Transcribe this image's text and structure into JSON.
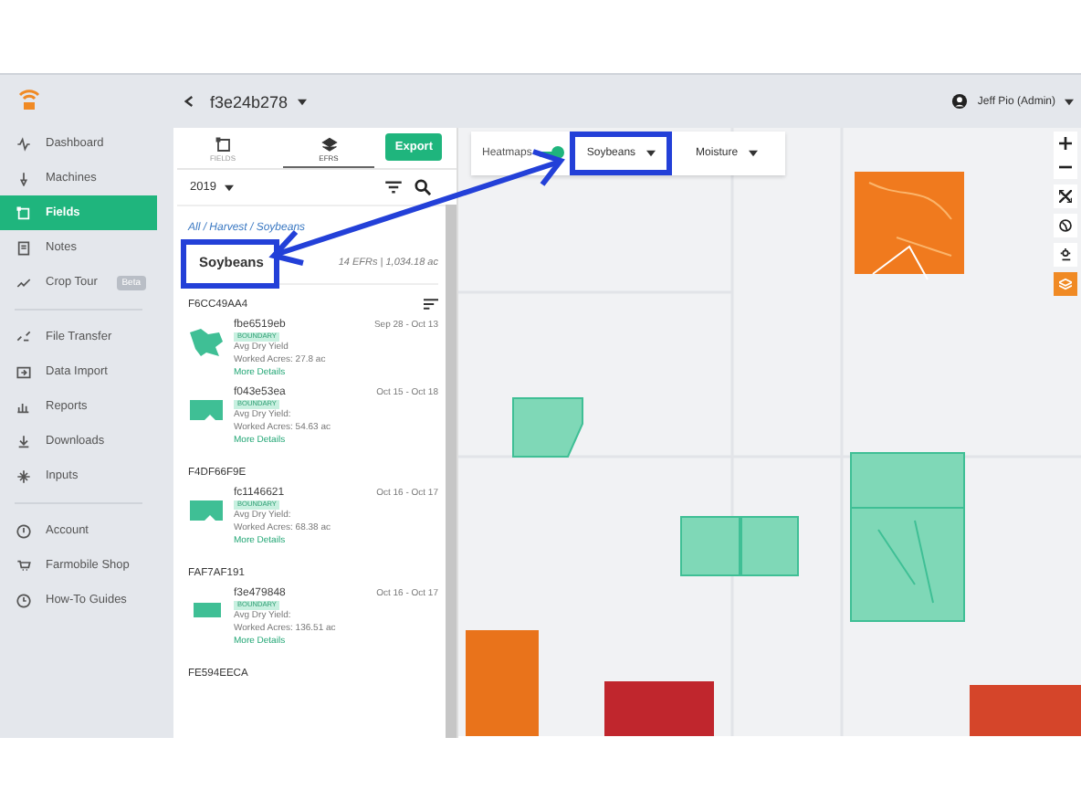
{
  "topbar": {
    "title": "f3e24b278",
    "user": "Jeff Pio (Admin)"
  },
  "sidebar": {
    "groups": [
      {
        "items": [
          {
            "label": "Dashboard",
            "selected": false
          },
          {
            "label": "Machines",
            "selected": false
          },
          {
            "label": "Fields",
            "selected": true
          },
          {
            "label": "Notes",
            "selected": false
          },
          {
            "label": "Crop Tour",
            "selected": false,
            "badge": "Beta"
          }
        ]
      },
      {
        "items": [
          {
            "label": "File Transfer",
            "selected": false
          },
          {
            "label": "Data Import",
            "selected": false
          },
          {
            "label": "Reports",
            "selected": false
          },
          {
            "label": "Downloads",
            "selected": false
          },
          {
            "label": "Inputs",
            "selected": false
          }
        ]
      },
      {
        "items": [
          {
            "label": "Account",
            "selected": false
          },
          {
            "label": "Farmobile Shop",
            "selected": false
          },
          {
            "label": "How-To Guides",
            "selected": false
          }
        ]
      }
    ]
  },
  "panel": {
    "tabs": [
      {
        "label": "FIELDS",
        "selected": false
      },
      {
        "label": "EFRS",
        "selected": true
      }
    ],
    "export": "Export",
    "year": "2019",
    "breadcrumb": "All / Harvest / Soybeans",
    "header": {
      "title": "Soybeans",
      "highlighted": true,
      "summary": "14 EFRs | 1,034.18 ac"
    },
    "groups": [
      {
        "label": "F6CC49AA4",
        "sort": true,
        "items": [
          {
            "name": "fbe6519eb",
            "dates": "Sep 28 - Oct 13",
            "tag": "BOUNDARY",
            "yield": "Avg Dry Yield",
            "acres": "Worked Acres: 27.8 ac",
            "link": "More Details"
          },
          {
            "name": "f043e53ea",
            "dates": "Oct 15 - Oct 18",
            "tag": "BOUNDARY",
            "yield": "Avg Dry Yield:",
            "acres": "Worked Acres: 54.63 ac",
            "link": "More Details"
          }
        ]
      },
      {
        "label": "F4DF66F9E",
        "sort": false,
        "items": [
          {
            "name": "fc1146621",
            "dates": "Oct 16 - Oct 17",
            "tag": "BOUNDARY",
            "yield": "Avg Dry Yield:",
            "acres": "Worked Acres: 68.38 ac",
            "link": "More Details"
          }
        ]
      },
      {
        "label": "FAF7AF191",
        "sort": false,
        "items": [
          {
            "name": "f3e479848",
            "dates": "Oct 16 - Oct 17",
            "tag": "BOUNDARY",
            "yield": "Avg Dry Yield:",
            "acres": "Worked Acres: 136.51 ac",
            "link": "More Details"
          }
        ]
      },
      {
        "label": "FE594EECA",
        "sort": false
      }
    ]
  },
  "map": {
    "heatmaps": {
      "label": "Heatmaps",
      "on": true
    },
    "dropdowns": [
      {
        "label": "Soybeans",
        "highlighted": true
      },
      {
        "label": "Moisture",
        "highlighted": false
      }
    ],
    "layers_active": true
  }
}
